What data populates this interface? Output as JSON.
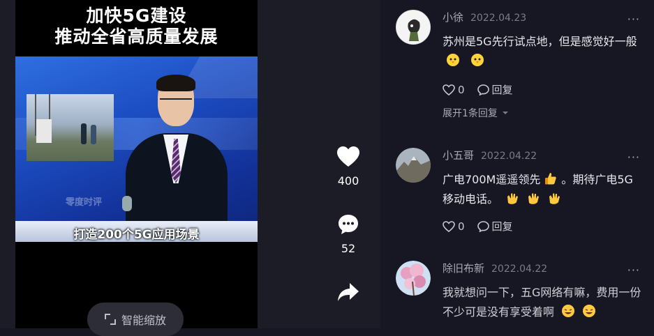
{
  "video": {
    "title_line1": "加快5G建设",
    "title_line2": "推动全省高质量发展",
    "watermark": "零度时评",
    "subtitle": "打造200个5G应用场景",
    "zoom_label": "智能缩放"
  },
  "rail": {
    "likes": "400",
    "comments": "52"
  },
  "comments": [
    {
      "user": "小徐",
      "date": "2022.04.23",
      "text": "苏州是5G先行试点地，但是感觉好一般",
      "emojis": [
        "chick-emoji",
        "chick-emoji"
      ],
      "likes": "0",
      "reply_label": "回复",
      "expand_label": "展开1条回复"
    },
    {
      "user": "小五哥",
      "date": "2022.04.22",
      "text_part1": "广电700M遥遥领先",
      "text_part2": "。期待广电5G移动电话。",
      "likes": "0",
      "reply_label": "回复"
    },
    {
      "user": "除旧布新",
      "date": "2022.04.22",
      "text": "我就想问一下，五G网络有嘛，费用一份不少可是没有享受着啊"
    }
  ],
  "more_label": "···",
  "colors": {
    "panel_bg": "#161722",
    "video_bg": "#000000",
    "accent_text": "#e8e8ec"
  }
}
